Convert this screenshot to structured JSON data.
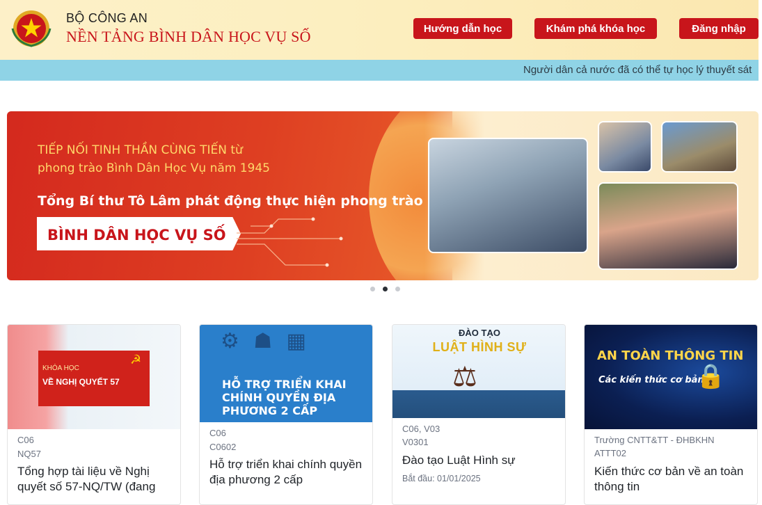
{
  "header": {
    "org_name": "BỘ CÔNG AN",
    "platform_name": "NỀN TẢNG BÌNH DÂN HỌC VỤ SỐ",
    "nav": [
      {
        "label": "Hướng dẫn học"
      },
      {
        "label": "Khám phá khóa học"
      },
      {
        "label": "Đăng nhập"
      }
    ],
    "colors": {
      "primary_red": "#c8151b",
      "header_bg": "#fcefc0",
      "ticker_bg": "#8fd3e6"
    }
  },
  "ticker": {
    "text": "Người dân cả nước đã có thể tự học lý thuyết sát"
  },
  "banner": {
    "line1": "TIẾP NỐI TINH THẦN CÙNG TIẾN từ",
    "line2": "phong trào Bình Dân Học Vụ năm 1945",
    "line3": "Tổng Bí thư Tô Lâm phát động thực hiện phong trào",
    "pill_text": "BÌNH DÂN HỌC VỤ SỐ",
    "carousel": {
      "total": 3,
      "active": 2
    }
  },
  "courses": [
    {
      "thumb_small": "KHÓA HỌC",
      "thumb_big": "VỀ NGHỊ QUYẾT 57",
      "meta1": "C06",
      "meta2": "NQ57",
      "title": "Tổng hợp tài liệu về Nghị quyết số 57-NQ/TW (đang"
    },
    {
      "thumb_text": "HỖ TRỢ TRIỂN KHAI CHÍNH QUYỀN ĐỊA PHƯƠNG 2 CẤP",
      "meta1": "C06",
      "meta2": "C0602",
      "title": "Hỗ trợ triển khai chính quyền địa phương 2 cấp"
    },
    {
      "thumb_small": "ĐÀO TẠO",
      "thumb_big": "LUẬT HÌNH SỰ",
      "meta1": "C06, V03",
      "meta2": "V0301",
      "title": "Đào tạo Luật Hình sự",
      "date": "Bắt đầu: 01/01/2025"
    },
    {
      "thumb_big": "AN TOÀN THÔNG TIN",
      "thumb_small": "Các kiến thức cơ bản",
      "meta1": "Trường CNTT&TT - ĐHBKHN",
      "meta2": "ATTT02",
      "title": "Kiến thức cơ bản về an toàn thông tin"
    }
  ]
}
